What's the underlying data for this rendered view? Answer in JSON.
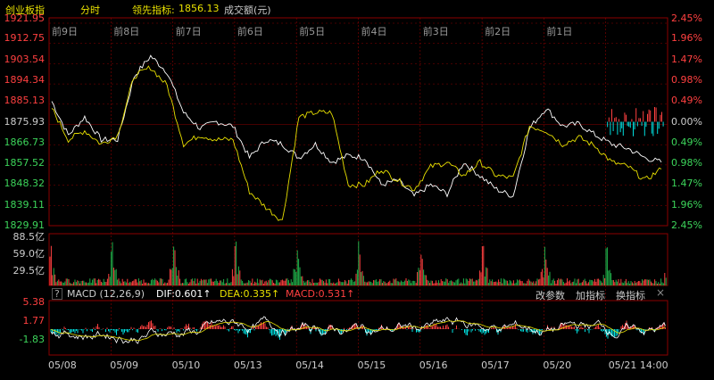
{
  "header": {
    "index_name": "创业板指",
    "mode": "分时",
    "leader_label": "领先指标:",
    "leader_value": "1856.13",
    "volume_label": "成交额(元)"
  },
  "price_axis": {
    "left": [
      "1921.95",
      "1912.75",
      "1903.54",
      "1894.34",
      "1885.13",
      "1875.93",
      "1866.73",
      "1857.52",
      "1848.32",
      "1839.11",
      "1829.91"
    ],
    "right": [
      "2.45%",
      "1.96%",
      "1.47%",
      "0.98%",
      "0.49%",
      "0.00%",
      "0.49%",
      "0.98%",
      "1.47%",
      "1.96%",
      "2.45%"
    ]
  },
  "day_labels": [
    "前9日",
    "前8日",
    "前7日",
    "前6日",
    "前5日",
    "前4日",
    "前3日",
    "前2日",
    "前1日"
  ],
  "volume_axis": [
    "88.5亿",
    "59.0亿",
    "29.5亿"
  ],
  "macd": {
    "help": "?",
    "title": "MACD (12,26,9)",
    "dif": "DIF:0.601↑",
    "dea": "DEA:0.335↑",
    "macd": "MACD:0.531↑",
    "buttons": [
      "改参数",
      "加指标",
      "换指标"
    ],
    "close": "×",
    "axis": [
      "5.38",
      "1.77",
      "-1.83"
    ]
  },
  "dates": [
    "05/08",
    "05/09",
    "05/10",
    "05/13",
    "05/14",
    "05/15",
    "05/16",
    "05/17",
    "05/20",
    "05/21 14:00"
  ],
  "colors": {
    "up": "#ff4040",
    "down": "#00e0e0",
    "dif": "#ffffff",
    "dea": "#e8e000",
    "axis": "#8b0000",
    "vol_green": "#1fb04a"
  },
  "chart_data": {
    "type": "line",
    "title": "创业板指",
    "ylim": [
      1829.91,
      1921.95
    ],
    "base": 1875.93,
    "series": [
      {
        "name": "创业板指",
        "values": [
          1885,
          1870,
          1878,
          1868,
          1868,
          1896,
          1905,
          1898,
          1880,
          1873,
          1876,
          1874,
          1860,
          1868,
          1866,
          1860,
          1866,
          1858,
          1861,
          1860,
          1848,
          1850,
          1843,
          1848,
          1844,
          1858,
          1852,
          1846,
          1843,
          1873,
          1882,
          1874,
          1875,
          1870,
          1866,
          1864,
          1860,
          1858
        ]
      },
      {
        "name": "领先指标",
        "values": [
          1882,
          1868,
          1872,
          1866,
          1870,
          1896,
          1900,
          1892,
          1866,
          1870,
          1868,
          1868,
          1845,
          1838,
          1832,
          1878,
          1880,
          1880,
          1848,
          1848,
          1855,
          1850,
          1846,
          1856,
          1858,
          1852,
          1858,
          1852,
          1851,
          1874,
          1872,
          1866,
          1869,
          1865,
          1858,
          1856,
          1850,
          1855
        ]
      }
    ]
  }
}
